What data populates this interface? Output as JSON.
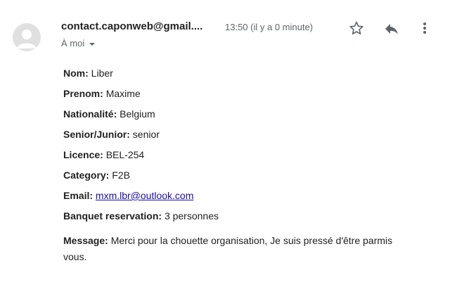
{
  "header": {
    "sender": "contact.caponweb@gmail....",
    "time": "13:50 (il y a 0 minute)",
    "recipient": "À moi"
  },
  "icons": {
    "avatar": "person-icon",
    "star": "star-outline-icon",
    "reply": "reply-icon",
    "more": "more-vert-icon"
  },
  "fields": [
    {
      "label": "Nom:",
      "value": "Liber"
    },
    {
      "label": "Prenom:",
      "value": "Maxime"
    },
    {
      "label": "Nationalité:",
      "value": "Belgium"
    },
    {
      "label": "Senior/Junior:",
      "value": "senior"
    },
    {
      "label": "Licence:",
      "value": "BEL-254"
    },
    {
      "label": "Category:",
      "value": "F2B"
    },
    {
      "label": "Email:",
      "value": "mxm.lbr@outlook.com"
    },
    {
      "label": "Banquet reservation:",
      "value": "3 personnes"
    }
  ],
  "message": {
    "label": "Message:",
    "value": "Merci pour la chouette organisation, Je suis pressé d'être parmis vous."
  },
  "colors": {
    "link": "#1a0dab",
    "secondary_text": "#5f6368",
    "avatar_bg": "#e0e0e0"
  }
}
